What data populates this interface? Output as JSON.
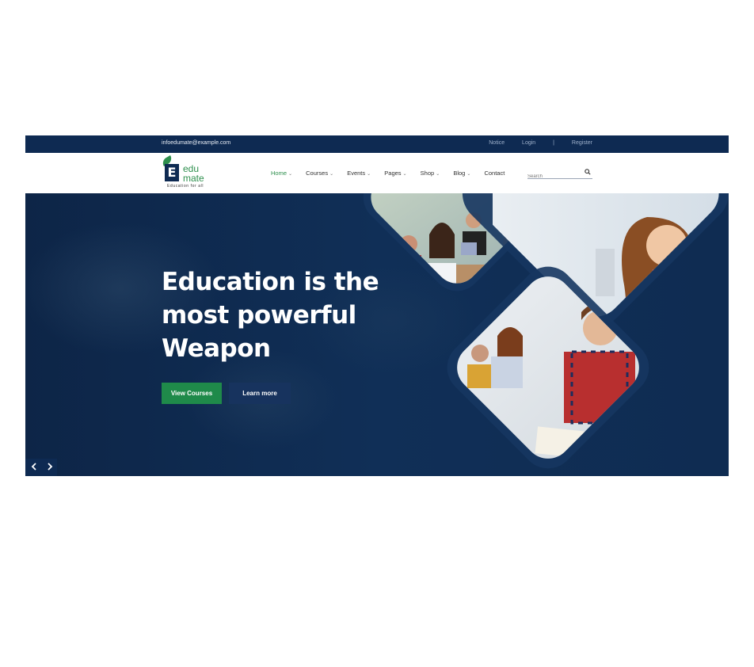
{
  "topbar": {
    "email": "infoedumate@example.com",
    "notice": "Notice",
    "login": "Login",
    "separator": "|",
    "register": "Register"
  },
  "logo": {
    "letter": "E",
    "line1": "edu",
    "line2": "mate",
    "tagline": "Education for all"
  },
  "nav": {
    "items": [
      {
        "label": "Home",
        "dropdown": true,
        "active": true
      },
      {
        "label": "Courses",
        "dropdown": true
      },
      {
        "label": "Events",
        "dropdown": true
      },
      {
        "label": "Pages",
        "dropdown": true
      },
      {
        "label": "Shop",
        "dropdown": true
      },
      {
        "label": "Blog",
        "dropdown": true
      },
      {
        "label": "Contact",
        "dropdown": false
      }
    ]
  },
  "search": {
    "placeholder": "Search",
    "icon": "search-icon"
  },
  "hero": {
    "line1": "Education is the",
    "line2": "most powerful",
    "line3": "Weapon",
    "primary_button": "View Courses",
    "secondary_button": "Learn more"
  },
  "colors": {
    "navy": "#0e2a52",
    "green": "#1f8a4a",
    "accent_text": "#2e8f4d"
  }
}
